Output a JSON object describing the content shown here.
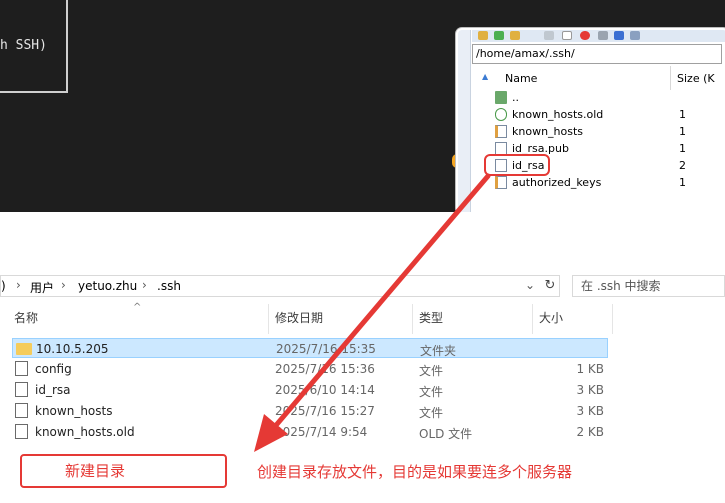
{
  "terminal": {
    "text": "h SSH)"
  },
  "winscp": {
    "path": "/home/amax/.ssh/",
    "columns": {
      "name": "Name",
      "size": "Size (K"
    },
    "files": [
      {
        "name": "..",
        "size": "",
        "icon": "folder-up-icon"
      },
      {
        "name": "known_hosts.old",
        "size": "1",
        "icon": "recycle-icon"
      },
      {
        "name": "known_hosts",
        "size": "1",
        "icon": "edit-file-icon"
      },
      {
        "name": "id_rsa.pub",
        "size": "1",
        "icon": "file-icon"
      },
      {
        "name": "id_rsa",
        "size": "2",
        "icon": "file-icon"
      },
      {
        "name": "authorized_keys",
        "size": "1",
        "icon": "edit-file-icon"
      }
    ]
  },
  "explorer": {
    "breadcrumb": [
      ")",
      "用户",
      "yetuo.zhu",
      ".ssh"
    ],
    "search_placeholder": "在 .ssh 中搜索",
    "columns": {
      "name": "名称",
      "modified": "修改日期",
      "type": "类型",
      "size": "大小"
    },
    "rows": [
      {
        "name": "10.10.5.205",
        "modified": "2025/7/16 15:35",
        "type": "文件夹",
        "size": "",
        "icon": "folder-icon"
      },
      {
        "name": "config",
        "modified": "2025/7/16 15:36",
        "type": "文件",
        "size": "1 KB",
        "icon": "file-icon"
      },
      {
        "name": "id_rsa",
        "modified": "2025/6/10 14:14",
        "type": "文件",
        "size": "3 KB",
        "icon": "file-icon"
      },
      {
        "name": "known_hosts",
        "modified": "2025/7/16 15:27",
        "type": "文件",
        "size": "3 KB",
        "icon": "file-icon"
      },
      {
        "name": "known_hosts.old",
        "modified": "2025/7/14 9:54",
        "type": "OLD 文件",
        "size": "2 KB",
        "icon": "file-icon"
      }
    ]
  },
  "annotation": {
    "new_dir_label": "新建目录",
    "note": "创建目录存放文件，目的是如果要连多个服务器"
  },
  "colors": {
    "accent_red": "#e53935",
    "selection": "#cce8ff",
    "terminal_bg": "#1e1e1e"
  }
}
